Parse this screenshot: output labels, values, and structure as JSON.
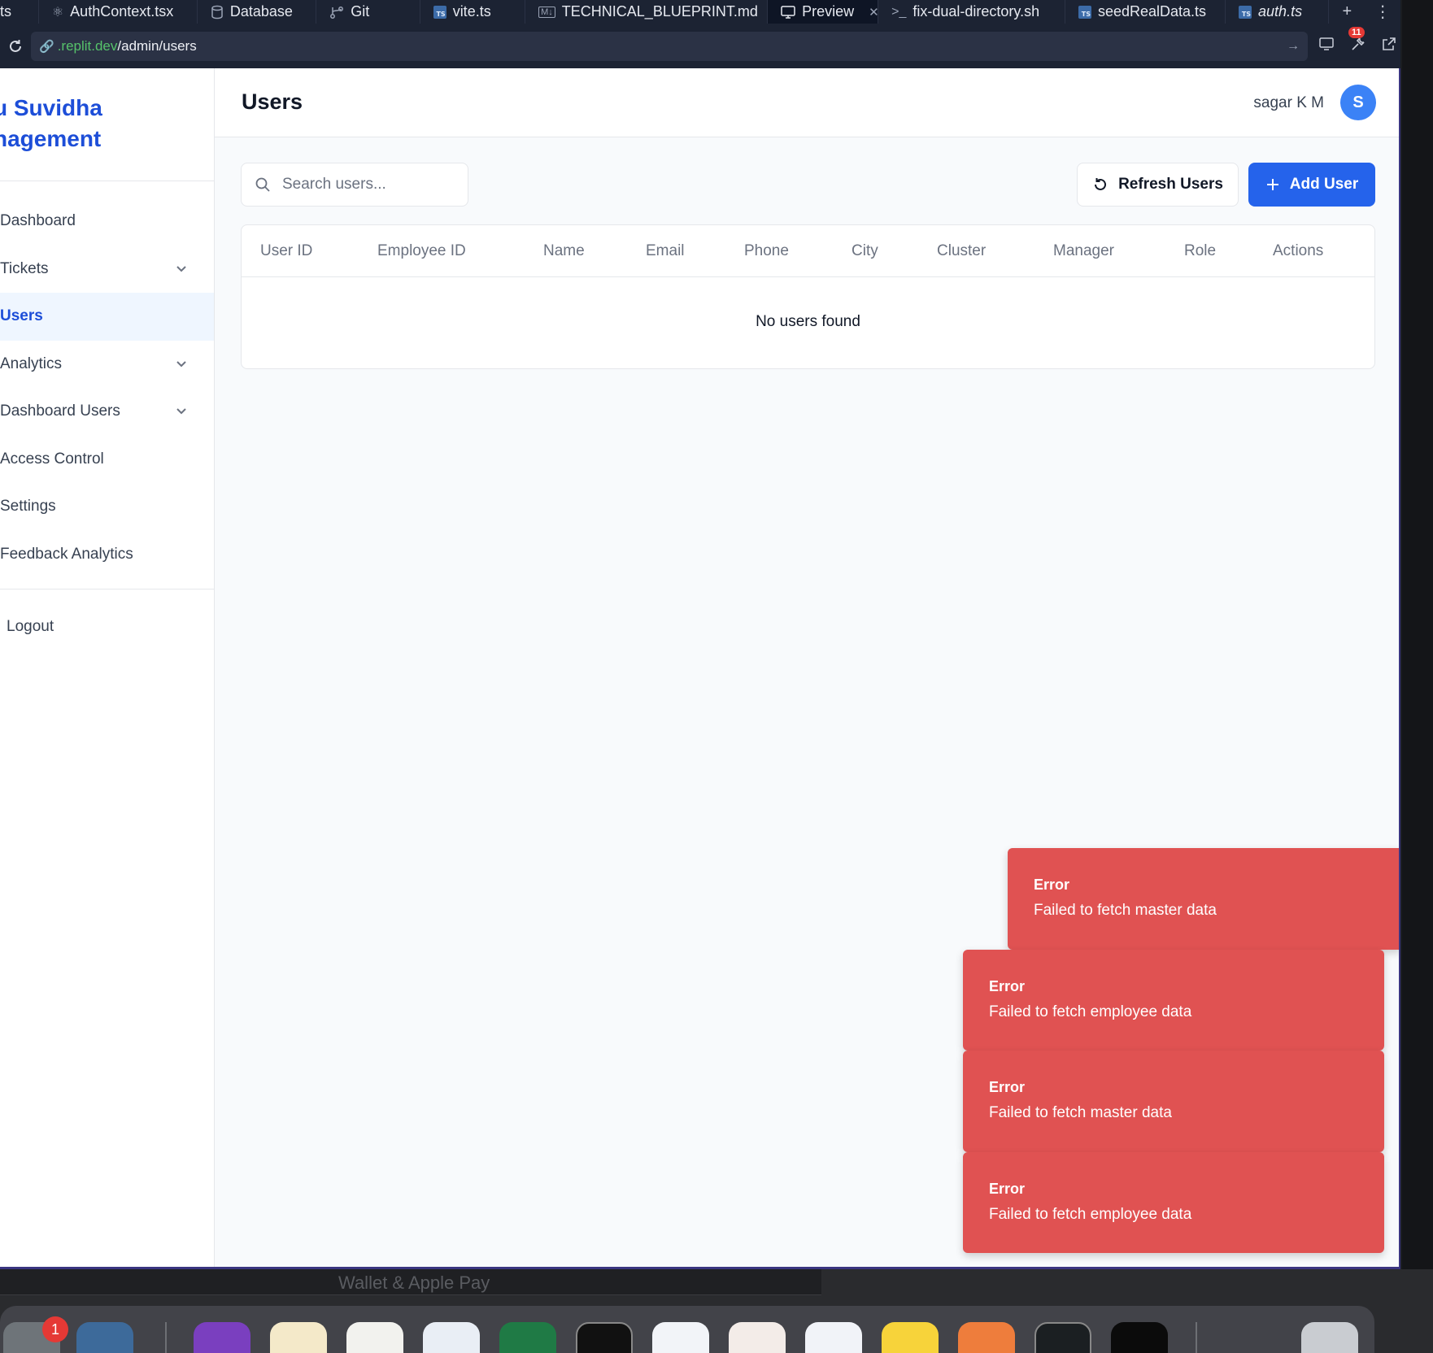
{
  "ide": {
    "tabs": [
      {
        "label": "ts",
        "icon": "none"
      },
      {
        "label": "AuthContext.tsx",
        "icon": "react-icon"
      },
      {
        "label": "Database",
        "icon": "database-icon"
      },
      {
        "label": "Git",
        "icon": "git-icon"
      },
      {
        "label": "vite.ts",
        "icon": "typescript-file-icon"
      },
      {
        "label": "TECHNICAL_BLUEPRINT.md",
        "icon": "markdown-file-icon"
      },
      {
        "label": "Preview",
        "icon": "monitor-icon",
        "active": true
      },
      {
        "label": "fix-dual-directory.sh",
        "icon": "terminal-icon"
      },
      {
        "label": "seedRealData.ts",
        "icon": "typescript-file-icon"
      },
      {
        "label": "auth.ts",
        "icon": "typescript-file-icon"
      }
    ],
    "url_host": ".replit.dev",
    "url_path": "/admin/users",
    "notification_count": "11"
  },
  "app": {
    "brand_line1": "u Suvidha",
    "brand_line2": "nagement",
    "nav": [
      {
        "label": "Dashboard",
        "has_children": false
      },
      {
        "label": "Tickets",
        "has_children": true
      },
      {
        "label": "Users",
        "has_children": false,
        "active": true
      },
      {
        "label": "Analytics",
        "has_children": true
      },
      {
        "label": "Dashboard Users",
        "has_children": true
      },
      {
        "label": "Access Control",
        "has_children": false
      },
      {
        "label": "Settings",
        "has_children": false
      },
      {
        "label": "Feedback Analytics",
        "has_children": false
      }
    ],
    "logout_label": "Logout",
    "page_title": "Users",
    "user_name": "sagar K M",
    "avatar_initial": "S",
    "search_placeholder": "Search users...",
    "refresh_label": "Refresh Users",
    "add_label": "Add User",
    "table_columns": [
      "User ID",
      "Employee ID",
      "Name",
      "Email",
      "Phone",
      "City",
      "Cluster",
      "Manager",
      "Role",
      "Actions"
    ],
    "empty_message": "No users found",
    "colors": {
      "brand": "#1d4ed8",
      "primary_button": "#2563eb",
      "toast_error": "#e05252"
    }
  },
  "toasts": [
    {
      "title": "Error",
      "message": "Failed to fetch master data"
    },
    {
      "title": "Error",
      "message": "Failed to fetch employee data"
    },
    {
      "title": "Error",
      "message": "Failed to fetch master data"
    },
    {
      "title": "Error",
      "message": "Failed to fetch employee data"
    }
  ],
  "dock": {
    "badge_count": "1",
    "background_text": "Wallet & Apple Pay"
  }
}
